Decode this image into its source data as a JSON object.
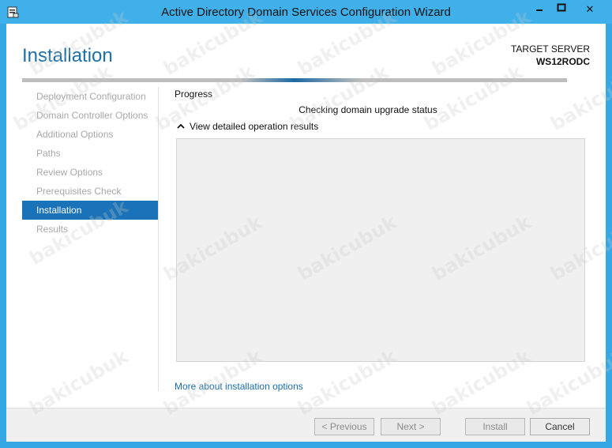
{
  "window": {
    "title": "Active Directory Domain Services Configuration Wizard",
    "titlebar_color": "#3fb0ea",
    "icon": "server-wizard-icon",
    "controls": {
      "minimize": "minimize-icon",
      "maximize": "maximize-icon",
      "close": "✕"
    }
  },
  "header": {
    "page_title": "Installation",
    "target_label": "TARGET SERVER",
    "target_server": "WS12RODC",
    "accent": "#1e6fa6"
  },
  "sidebar": {
    "items": [
      {
        "label": "Deployment Configuration",
        "active": false
      },
      {
        "label": "Domain Controller Options",
        "active": false
      },
      {
        "label": "Additional Options",
        "active": false
      },
      {
        "label": "Paths",
        "active": false
      },
      {
        "label": "Review Options",
        "active": false
      },
      {
        "label": "Prerequisites Check",
        "active": false
      },
      {
        "label": "Installation",
        "active": true
      },
      {
        "label": "Results",
        "active": false
      }
    ],
    "active_color": "#1a73b8"
  },
  "main": {
    "progress_heading": "Progress",
    "status_text": "Checking domain upgrade status",
    "expander_label": "View detailed operation results",
    "more_link": "More about installation options"
  },
  "footer": {
    "previous": "< Previous",
    "next": "Next >",
    "install": "Install",
    "cancel": "Cancel"
  },
  "watermark": "bakicubuk"
}
